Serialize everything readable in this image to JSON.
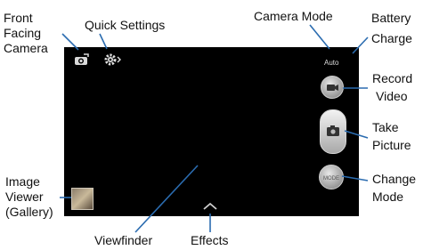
{
  "labels": {
    "front_facing_camera": [
      "Front",
      "Facing",
      "Camera"
    ],
    "quick_settings": "Quick Settings",
    "camera_mode": "Camera  Mode",
    "battery_charge": [
      "Battery",
      "Charge"
    ],
    "record_video": [
      "Record",
      "Video"
    ],
    "take_picture": [
      "Take",
      "Picture"
    ],
    "change_mode": [
      "Change",
      "Mode"
    ],
    "image_viewer": [
      "Image",
      "Viewer",
      "(Gallery)"
    ],
    "viewfinder": "Viewfinder",
    "effects": "Effects"
  },
  "screen": {
    "mode_text": "Auto"
  },
  "icons": {
    "front_camera": "camera-switch-icon",
    "settings": "gear-icon",
    "record": "video-camera-icon",
    "shutter": "camera-icon",
    "mode": "mode-icon",
    "effects": "chevron-up-icon",
    "gallery": "gallery-thumbnail"
  },
  "colors": {
    "screen_bg": "#000000",
    "leader_lines": "#2b6cb0"
  }
}
